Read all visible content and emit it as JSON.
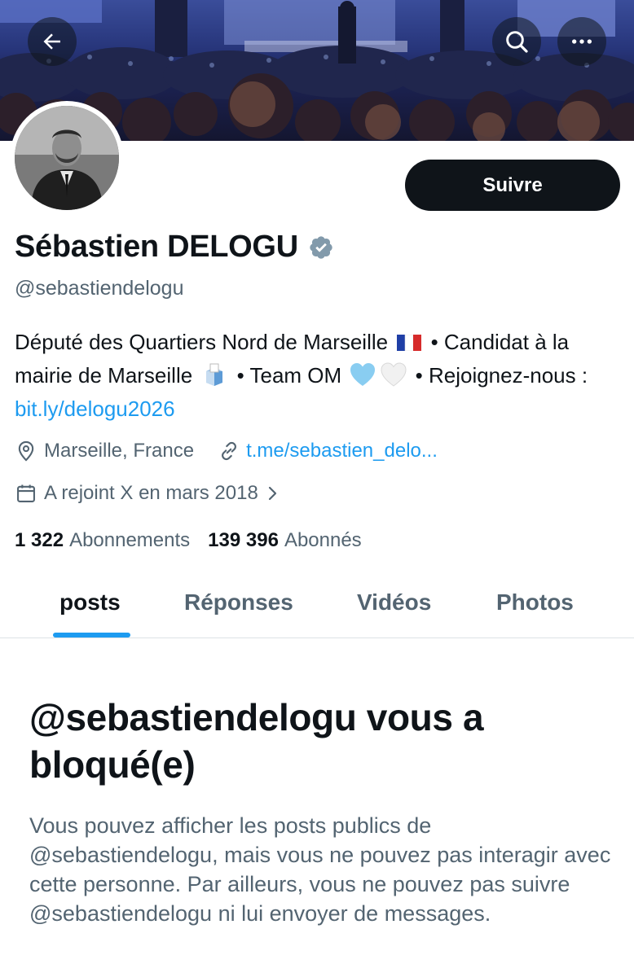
{
  "profile": {
    "display_name": "Sébastien DELOGU",
    "handle": "@sebastiendelogu",
    "follow_label": "Suivre",
    "bio": {
      "text_1": "Député des Quartiers Nord de Marseille",
      "text_2": " • Candidat à la mairie de Marseille",
      "text_3": " • Team OM",
      "text_4": " • Rejoignez-nous : ",
      "link": "bit.ly/delogu2026"
    },
    "location": "Marseille, France",
    "url": "t.me/sebastien_delo...",
    "joined": "A rejoint X en mars 2018",
    "following_count": "1 322",
    "following_label": "Abonnements",
    "followers_count": "139 396",
    "followers_label": "Abonnés"
  },
  "tabs": [
    {
      "label": "posts",
      "active": true
    },
    {
      "label": "Réponses",
      "active": false
    },
    {
      "label": "Vidéos",
      "active": false
    },
    {
      "label": "Photos",
      "active": false
    }
  ],
  "blocked": {
    "title": "@sebastiendelogu vous a bloqué(e)",
    "description": "Vous pouvez afficher les posts publics de @sebastiendelogu, mais vous ne pouvez pas interagir avec cette personne. Par ailleurs, vous ne pouvez pas suivre @sebastiendelogu ni lui envoyer de messages."
  },
  "colors": {
    "accent": "#1d9bf0",
    "text_primary": "#0f1419",
    "text_secondary": "#536471",
    "verified_badge": "#829aab"
  },
  "icons": [
    "back-arrow-icon",
    "search-icon",
    "more-icon",
    "verified-icon",
    "location-icon",
    "link-icon",
    "calendar-icon",
    "chevron-right-icon"
  ]
}
